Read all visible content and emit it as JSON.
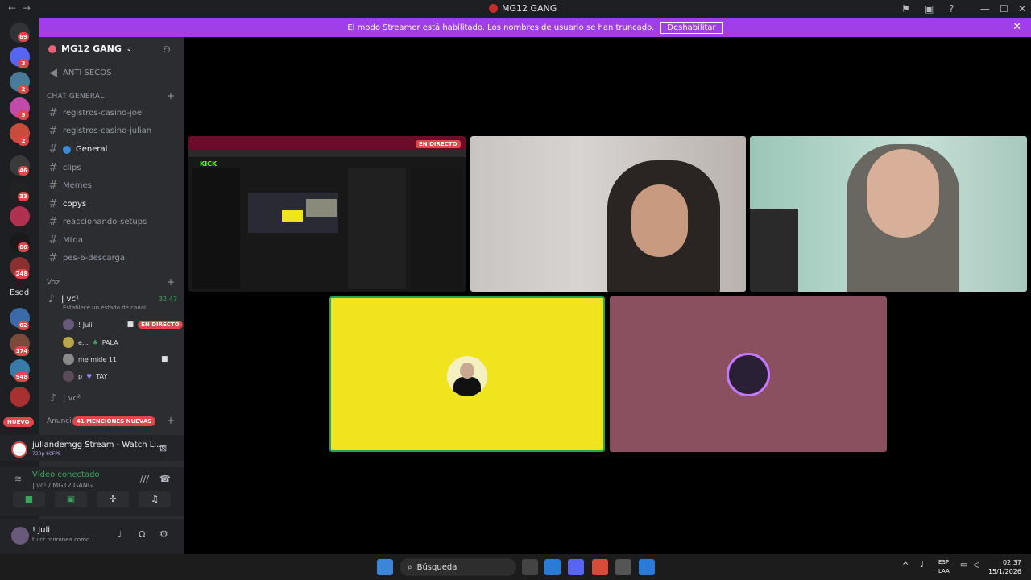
{
  "window": {
    "title": "MG12 GANG",
    "back": "←",
    "forward": "→"
  },
  "streamer_banner": {
    "text": "El modo Streamer está habilitado. Los nombres de usuario se han truncado.",
    "button": "Deshabilitar"
  },
  "rail_badges": [
    "69",
    "3",
    "2",
    "5",
    "2",
    "46",
    "33",
    "66",
    "248",
    "Esdd",
    "62",
    "174",
    "948"
  ],
  "guild": {
    "name": "MG12 GANG"
  },
  "channels": {
    "anti": "ANTI SECOS",
    "category_general": "CHAT GENERAL",
    "items": [
      "registros-casino-joel",
      "registros-casino-julian",
      "General",
      "clips",
      "Memes",
      "copys",
      "reaccionando-setups",
      "Mtda",
      "pes-6-descarga"
    ],
    "category_voice": "Voz",
    "voice1": {
      "name": "| vc¹",
      "timer": "32:47",
      "status": "Establece un estado de canal"
    },
    "voice_users": [
      {
        "name": "! Juli",
        "tag": "EN DIRECTO"
      },
      {
        "name": "e...",
        "tag": "PALA"
      },
      {
        "name": "me mide 11",
        "tag": ""
      },
      {
        "name": "p",
        "tag": "TAY"
      }
    ],
    "voice2": "| vc²",
    "announce": "Anunci",
    "new_badge": "NUEVO",
    "mentions": "41 MENCIONES NUEVAS"
  },
  "stream_panel": {
    "title": "juliandemgg Stream - Watch Li...",
    "sub": "720p 60FPS"
  },
  "voice_panel": {
    "title": "Vídeo conectado",
    "sub": "| vc¹ / MG12 GANG"
  },
  "user_panel": {
    "name": "! Juli",
    "status": "tu cr ronronea como..."
  },
  "stream_tile": {
    "live": "EN DIRECTO",
    "kick": "KICK"
  },
  "taskbar": {
    "search": "Búsqueda",
    "lang1": "ESP",
    "lang2": "LAA",
    "time": "02:37",
    "date": "15/1/2026"
  },
  "colors": {
    "accent": "#a03ee8",
    "yellow_tile": "#f0e41e",
    "rose_tile": "#8b5060",
    "live_red": "#e0464a"
  }
}
